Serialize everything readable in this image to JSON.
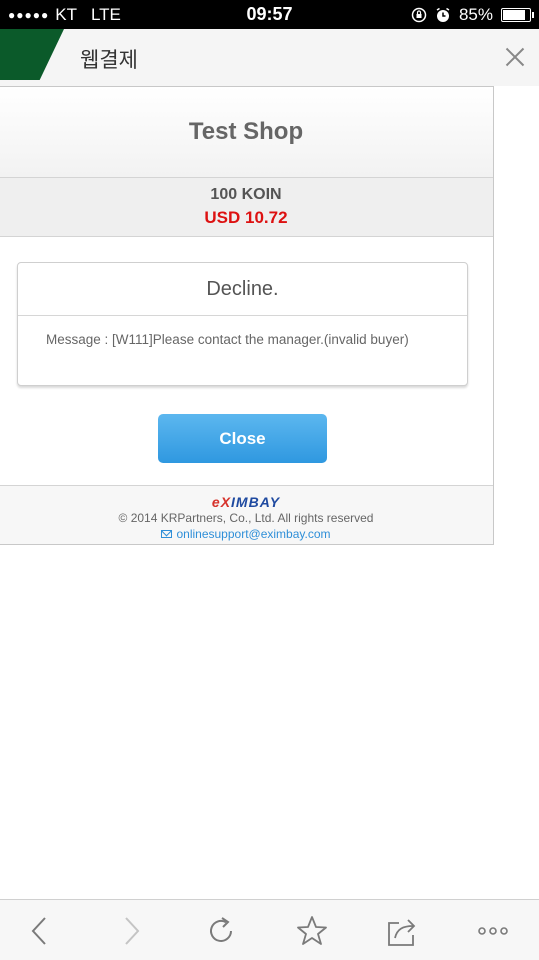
{
  "status_bar": {
    "carrier": "KT",
    "network": "LTE",
    "time": "09:57",
    "battery": "85%",
    "battery_level": 0.85,
    "icons": [
      "signal-dots",
      "orientation-lock-icon",
      "alarm-icon",
      "battery-icon"
    ]
  },
  "app_bar": {
    "title": "웹결제",
    "close_icon": "close-icon"
  },
  "payment": {
    "shop_name": "Test Shop",
    "product": "100 KOIN",
    "amount": "USD 10.72",
    "amount_color": "#dd1111",
    "result_title": "Decline.",
    "message": "Message : [W111]Please contact the manager.(invalid buyer)",
    "close_label": "Close",
    "button_color": "#3a9fe4"
  },
  "footer": {
    "logo_prefix": "e",
    "logo_x": "X",
    "logo_suffix": "IMBAY",
    "copyright": "© 2014 KRPartners, Co., Ltd. All rights reserved",
    "email": "onlinesupport@eximbay.com"
  },
  "toolbar": {
    "icons": [
      "back-icon",
      "forward-icon",
      "reload-icon",
      "bookmark-star-icon",
      "share-icon",
      "more-icon"
    ]
  }
}
